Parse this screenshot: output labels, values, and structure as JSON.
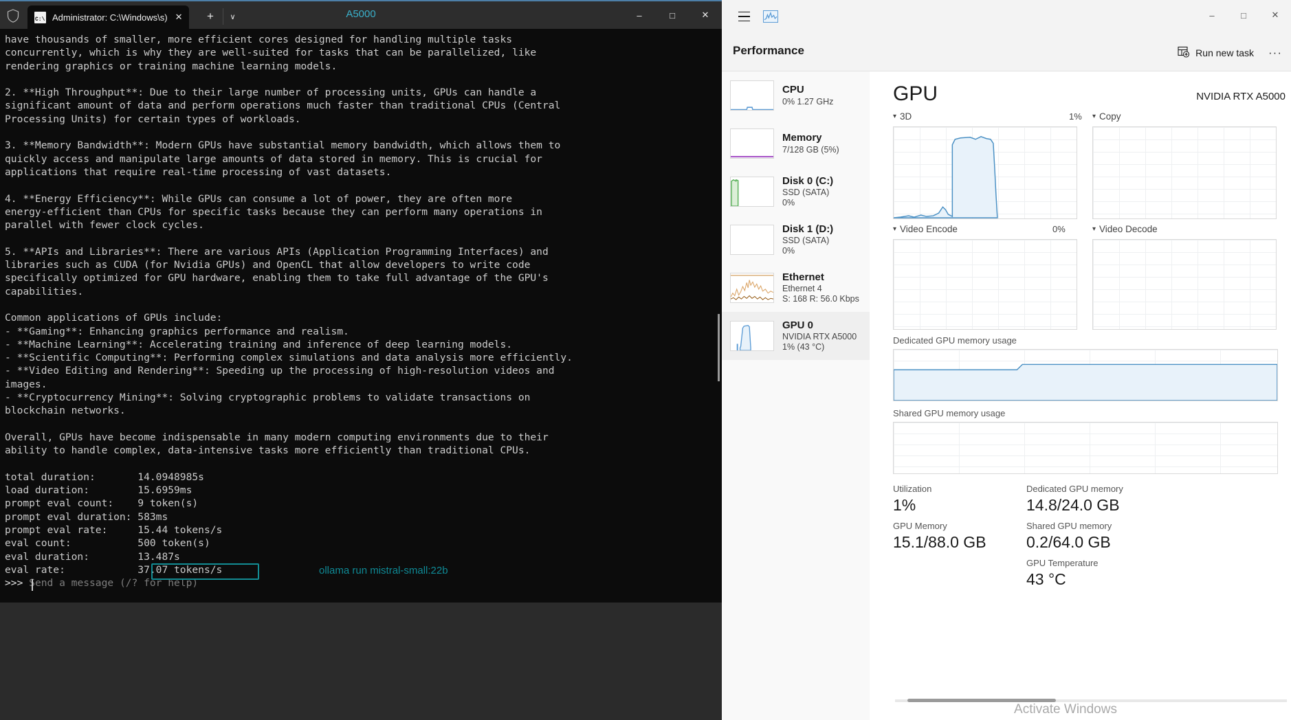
{
  "terminal": {
    "window_title": "A5000",
    "tab_title": "Administrator: C:\\Windows\\s)",
    "tab_icon_label": "C:\\",
    "new_tab_label": "+",
    "dropdown_label": "∨",
    "shield_icon": "shield-icon",
    "minimize_label": "–",
    "maximize_label": "□",
    "close_label": "✕",
    "output": "have thousands of smaller, more efficient cores designed for handling multiple tasks\nconcurrently, which is why they are well-suited for tasks that can be parallelized, like\nrendering graphics or training machine learning models.\n\n2. **High Throughput**: Due to their large number of processing units, GPUs can handle a\nsignificant amount of data and perform operations much faster than traditional CPUs (Central\nProcessing Units) for certain types of workloads.\n\n3. **Memory Bandwidth**: Modern GPUs have substantial memory bandwidth, which allows them to\nquickly access and manipulate large amounts of data stored in memory. This is crucial for\napplications that require real-time processing of vast datasets.\n\n4. **Energy Efficiency**: While GPUs can consume a lot of power, they are often more\nenergy-efficient than CPUs for specific tasks because they can perform many operations in\nparallel with fewer clock cycles.\n\n5. **APIs and Libraries**: There are various APIs (Application Programming Interfaces) and\nlibraries such as CUDA (for Nvidia GPUs) and OpenCL that allow developers to write code\nspecifically optimized for GPU hardware, enabling them to take full advantage of the GPU's\ncapabilities.\n\nCommon applications of GPUs include:\n- **Gaming**: Enhancing graphics performance and realism.\n- **Machine Learning**: Accelerating training and inference of deep learning models.\n- **Scientific Computing**: Performing complex simulations and data analysis more efficiently.\n- **Video Editing and Rendering**: Speeding up the processing of high-resolution videos and\nimages.\n- **Cryptocurrency Mining**: Solving cryptographic problems to validate transactions on\nblockchain networks.\n\nOverall, GPUs have become indispensable in many modern computing environments due to their\nability to handle complex, data-intensive tasks more efficiently than traditional CPUs.\n\ntotal duration:       14.0948985s\nload duration:        15.6959ms\nprompt eval count:    9 token(s)\nprompt eval duration: 583ms\nprompt eval rate:     15.44 tokens/s\neval count:           500 token(s)\neval duration:        13.487s\neval rate:            37.07 tokens/s\n",
    "prompt_symbol": ">>> ",
    "prompt_placeholder": "Send a message (/? for help)",
    "stats": {
      "total_duration": "14.0948985s",
      "load_duration": "15.6959ms",
      "prompt_eval_count": "9 token(s)",
      "prompt_eval_duration": "583ms",
      "prompt_eval_rate": "15.44 tokens/s",
      "eval_count": "500 token(s)",
      "eval_duration": "13.487s",
      "eval_rate": "37.07 tokens/s"
    },
    "annotation_text": "ollama run mistral-small:22b",
    "highlight_color": "#138d94",
    "annotation_color": "#0f8a96",
    "title_color": "#3aafc9"
  },
  "taskmanager": {
    "window_controls": {
      "minimize": "–",
      "maximize": "□",
      "close": "✕"
    },
    "hamburger_icon": "hamburger-menu-icon",
    "performance_icon": "performance-icon",
    "header_title": "Performance",
    "run_new_task_label": "Run new task",
    "run_new_task_icon": "add-task-icon",
    "more_options_label": "···",
    "sidebar": [
      {
        "name": "CPU",
        "sub1": "0%  1.27 GHz",
        "sub2": "",
        "selected": false,
        "color": "#5b9bd5"
      },
      {
        "name": "Memory",
        "sub1": "7/128 GB (5%)",
        "sub2": "",
        "selected": false,
        "color": "#a855c8"
      },
      {
        "name": "Disk 0 (C:)",
        "sub1": "SSD (SATA)",
        "sub2": "0%",
        "selected": false,
        "color": "#4eaa4e"
      },
      {
        "name": "Disk 1 (D:)",
        "sub1": "SSD (SATA)",
        "sub2": "0%",
        "selected": false,
        "color": "#4eaa4e"
      },
      {
        "name": "Ethernet",
        "sub1": "Ethernet 4",
        "sub2": "S: 168 R: 56.0 Kbps",
        "selected": false,
        "color": "#c98a3e"
      },
      {
        "name": "GPU 0",
        "sub1": "NVIDIA RTX A5000",
        "sub2": "1%  (43 °C)",
        "selected": true,
        "color": "#5b9bd5"
      }
    ],
    "gpu": {
      "title": "GPU",
      "model": "NVIDIA RTX A5000",
      "charts": [
        {
          "label": "3D",
          "pct": "1%"
        },
        {
          "label": "Copy",
          "pct": ""
        },
        {
          "label": "Video Encode",
          "pct": "0%"
        },
        {
          "label": "Video Decode",
          "pct": ""
        }
      ],
      "dedicated_usage_label": "Dedicated GPU memory usage",
      "shared_usage_label": "Shared GPU memory usage",
      "stats": [
        {
          "label": "Utilization",
          "value": "1%"
        },
        {
          "label": "Dedicated GPU memory",
          "value": "14.8/24.0 GB"
        },
        {
          "label": "GPU Memory",
          "value": "15.1/88.0 GB"
        },
        {
          "label": "Shared GPU memory",
          "value": "0.2/64.0 GB"
        },
        {
          "label": "GPU Temperature",
          "value": "43 °C"
        }
      ]
    },
    "watermark": "Activate Windows"
  }
}
